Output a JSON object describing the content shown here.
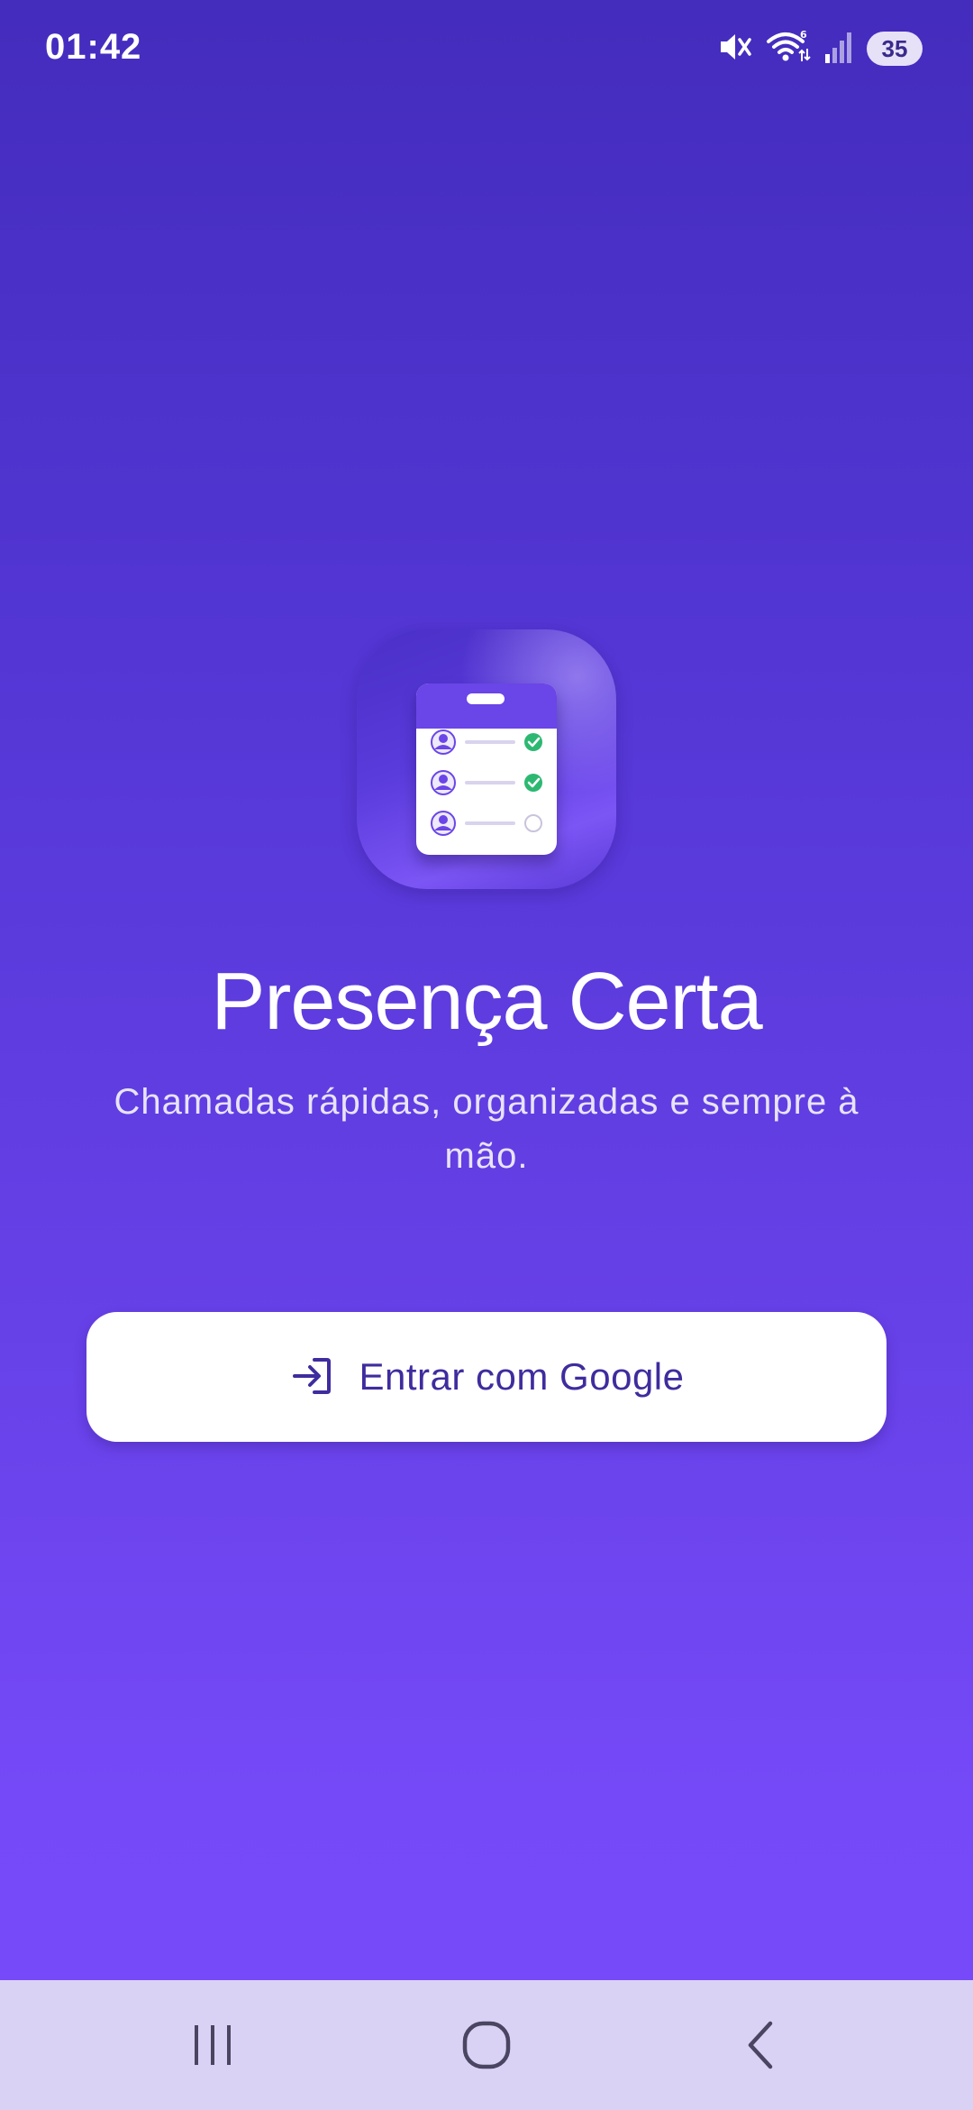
{
  "status_bar": {
    "time": "01:42",
    "battery": "35",
    "icons": [
      "mute-icon",
      "wifi-icon",
      "signal-icon",
      "battery-icon"
    ]
  },
  "app": {
    "icon": "attendance-clipboard-icon",
    "title": "Presença Certa",
    "subtitle": "Chamadas rápidas, organizadas e sempre à mão."
  },
  "login": {
    "button_label": "Entrar com Google",
    "button_icon": "login-icon"
  },
  "nav_bar": {
    "icons": [
      "recents-icon",
      "home-icon",
      "back-icon"
    ]
  },
  "colors": {
    "gradient_top": "#442CBD",
    "gradient_bottom": "#784BFA",
    "accent": "#6A45E8",
    "check_green": "#2DB872",
    "button_text": "#3F2C9E",
    "nav_bar": "#DAD2F4"
  }
}
